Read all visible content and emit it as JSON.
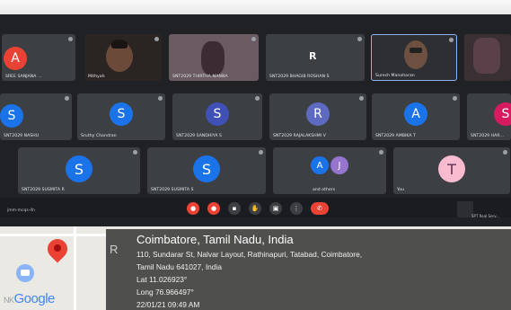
{
  "meet": {
    "meeting_code": "jmm-mcqs-ifn",
    "participants": [
      {
        "name": "SREE SANJANA ...",
        "initial": "A",
        "color": "#ea4335"
      },
      {
        "name": "Mithyah",
        "initial": "",
        "color": ""
      },
      {
        "name": "SNT2029 THIRTHA MANNA",
        "initial": "",
        "color": ""
      },
      {
        "name": "SNT2029 BHAGIB ROSHAN S",
        "initial": "R",
        "color": ""
      },
      {
        "name": "Suresh Manoharan",
        "initial": "",
        "color": ""
      },
      {
        "name": "SNT2029 NASHU",
        "initial": "S",
        "color": "#1a73e8"
      },
      {
        "name": "Sruthy Chandran",
        "initial": "S",
        "color": "#1a73e8"
      },
      {
        "name": "SNT2029 SANDHIYA S",
        "initial": "S",
        "color": "#3f51b5"
      },
      {
        "name": "SNT2029 RAJALAKSHMI V",
        "initial": "R",
        "color": "#5c6bc0"
      },
      {
        "name": "SNT2029 AMBIKA T",
        "initial": "A",
        "color": "#1a73e8"
      },
      {
        "name": "SNT2029 HAR...",
        "initial": "S",
        "color": "#d81b60"
      },
      {
        "name": "SNT2029 SUSMITA R",
        "initial": "S",
        "color": "#1a73e8"
      },
      {
        "name": "SNT2029 SUSMITA S",
        "initial": "S",
        "color": "#1a73e8"
      },
      {
        "name": "and others",
        "initial": "A",
        "color": "#1a73e8"
      },
      {
        "name": "You",
        "initial": "T",
        "color": "#f8bbd0"
      }
    ],
    "sidebar_label": "SPT Real Serv..."
  },
  "maps": {
    "logo_text": "Google",
    "logo_prefix": "NK"
  },
  "geotag": {
    "title": "Coimbatore, Tamil Nadu, India",
    "address_line1": "110, Sundarar St, Nalvar Layout, Rathinapuri, Tatabad, Coimbatore,",
    "address_line2": "Tamil Nadu 641027, India",
    "lat": "Lat 11.026923°",
    "long": "Long 76.966497°",
    "timestamp": "22/01/21 09:49 AM",
    "left_letter": "R"
  },
  "colors": {
    "meet_bg": "#202124",
    "tile_bg": "#3c4043",
    "accent_red": "#ea4335",
    "accent_blue": "#1a73e8"
  }
}
